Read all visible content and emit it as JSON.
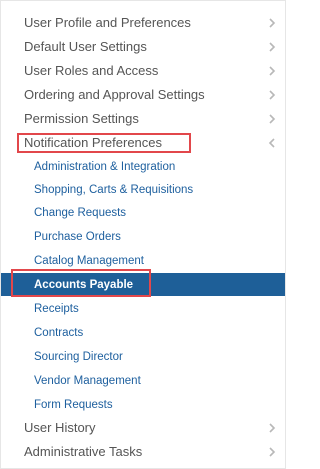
{
  "menu": {
    "top_items_before": [
      {
        "label": "User Profile and Preferences",
        "icon": "chevron-right-icon"
      },
      {
        "label": "Default User Settings",
        "icon": "chevron-right-icon"
      },
      {
        "label": "User Roles and Access",
        "icon": "chevron-right-icon"
      },
      {
        "label": "Ordering and Approval Settings",
        "icon": "chevron-right-icon"
      },
      {
        "label": "Permission Settings",
        "icon": "chevron-right-icon"
      }
    ],
    "expanded_item": {
      "label": "Notification Preferences",
      "icon": "chevron-left-icon"
    },
    "sub_items": [
      {
        "label": "Administration & Integration"
      },
      {
        "label": "Shopping, Carts & Requisitions"
      },
      {
        "label": "Change Requests"
      },
      {
        "label": "Purchase Orders"
      },
      {
        "label": "Catalog Management"
      },
      {
        "label": "Accounts Payable",
        "selected": true
      },
      {
        "label": "Receipts"
      },
      {
        "label": "Contracts"
      },
      {
        "label": "Sourcing Director"
      },
      {
        "label": "Vendor Management"
      },
      {
        "label": "Form Requests"
      }
    ],
    "top_items_after": [
      {
        "label": "User History",
        "icon": "chevron-right-icon"
      },
      {
        "label": "Administrative Tasks",
        "icon": "chevron-right-icon"
      }
    ]
  },
  "colors": {
    "top_text": "#555555",
    "sub_text": "#1d5f9e",
    "selected_background": "#1e5f98",
    "selected_text": "#ffffff",
    "highlight_border": "#e2474b"
  }
}
